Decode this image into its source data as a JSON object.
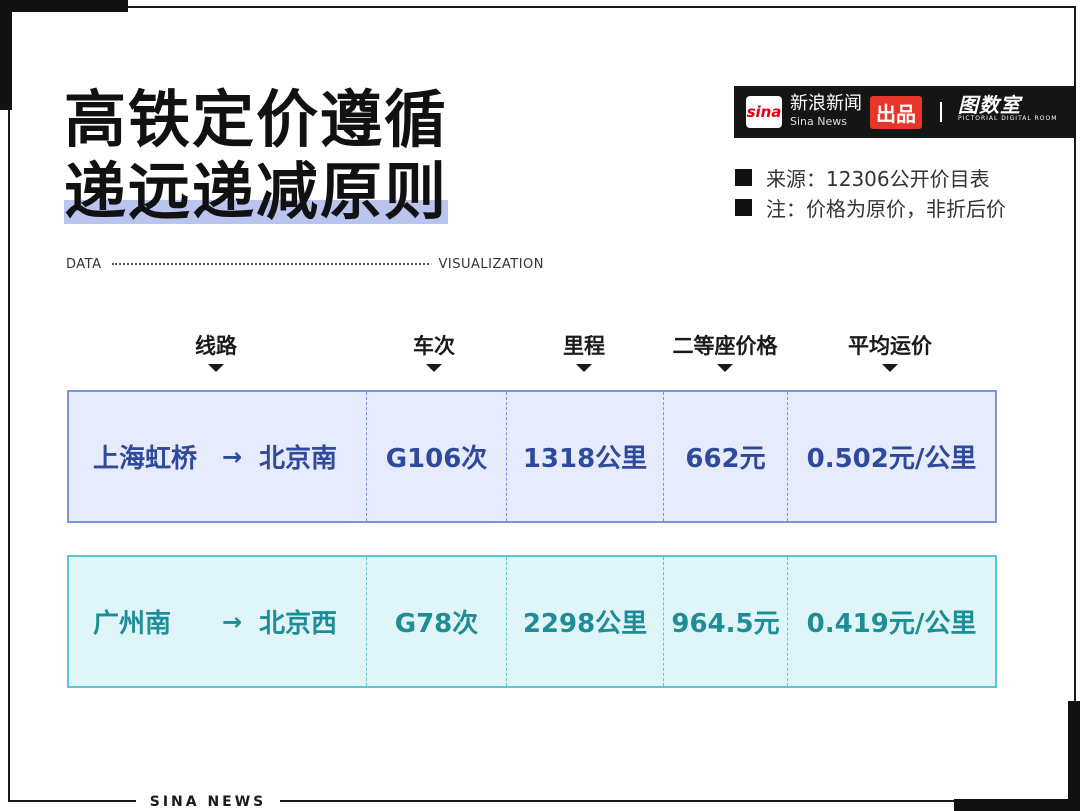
{
  "title": {
    "line1": "高铁定价遵循",
    "line2": "递远递减原则"
  },
  "subtitle": {
    "left": "DATA",
    "right": "VISUALIZATION"
  },
  "brand": {
    "logo_text": "sina",
    "name_cn": "新浪新闻",
    "name_en": "Sina News",
    "badge": "出品",
    "partner_cn": "图数室",
    "partner_en": "PICTORIAL DIGITAL ROOM"
  },
  "notes": [
    {
      "text": "来源：12306公开价目表"
    },
    {
      "text": "注：价格为原价，非折后价"
    }
  ],
  "table": {
    "headers": [
      "线路",
      "车次",
      "里程",
      "二等座价格",
      "平均运价"
    ],
    "rows": [
      {
        "from": "上海虹桥",
        "arrow": "→",
        "to": "北京南",
        "train": "G106次",
        "distance": "1318公里",
        "price": "662元",
        "avg": "0.502元/公里"
      },
      {
        "from": "广州南",
        "arrow": "→",
        "to": "北京西",
        "train": "G78次",
        "distance": "2298公里",
        "price": "964.5元",
        "avg": "0.419元/公里"
      }
    ]
  },
  "footer": "SINA NEWS",
  "colors": {
    "row1_bg": "#e6ebfd",
    "row1_border": "#7e93d8",
    "row1_text": "#2f4a9b",
    "row2_bg": "#e0f5f8",
    "row2_border": "#5cc7d2",
    "row2_text": "#1d8d98",
    "highlight": "#b9c5ee",
    "brand_red": "#e8352a"
  }
}
